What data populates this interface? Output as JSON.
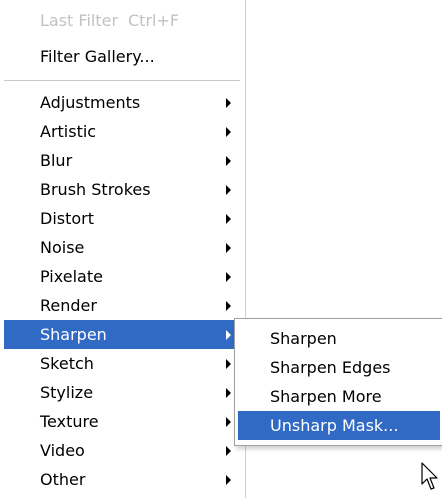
{
  "menu": {
    "last_filter": {
      "label": "Last Filter",
      "shortcut": "Ctrl+F"
    },
    "filter_gallery": "Filter Gallery...",
    "items": [
      {
        "label": "Adjustments"
      },
      {
        "label": "Artistic"
      },
      {
        "label": "Blur"
      },
      {
        "label": "Brush Strokes"
      },
      {
        "label": "Distort"
      },
      {
        "label": "Noise"
      },
      {
        "label": "Pixelate"
      },
      {
        "label": "Render"
      },
      {
        "label": "Sharpen"
      },
      {
        "label": "Sketch"
      },
      {
        "label": "Stylize"
      },
      {
        "label": "Texture"
      },
      {
        "label": "Video"
      },
      {
        "label": "Other"
      }
    ],
    "highlighted": "Sharpen"
  },
  "submenu": {
    "items": [
      {
        "label": "Sharpen"
      },
      {
        "label": "Sharpen Edges"
      },
      {
        "label": "Sharpen More"
      },
      {
        "label": "Unsharp Mask..."
      }
    ],
    "highlighted": "Unsharp Mask..."
  },
  "colors": {
    "highlight": "#316ac5",
    "disabled_text": "#c2c2c2"
  },
  "icons": {
    "submenu_arrow": "triangle-right-icon",
    "cursor": "arrow-pointer-icon"
  }
}
